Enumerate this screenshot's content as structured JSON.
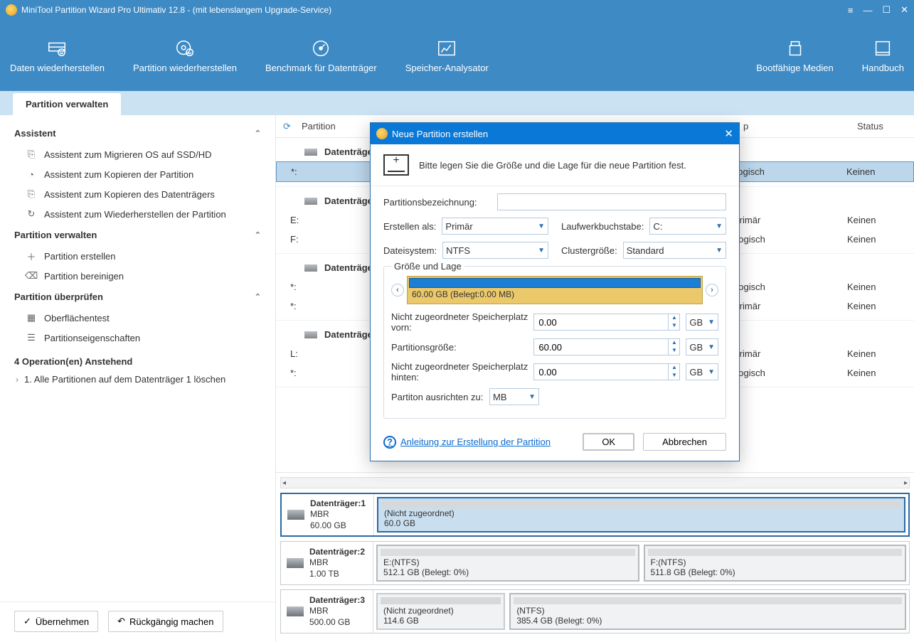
{
  "titlebar": {
    "title": "MiniTool Partition Wizard Pro Ultimativ 12.8 - (mit lebenslangem Upgrade-Service)"
  },
  "ribbon": {
    "items": [
      {
        "label": "Daten wiederherstellen"
      },
      {
        "label": "Partition wiederherstellen"
      },
      {
        "label": "Benchmark für Datenträger"
      },
      {
        "label": "Speicher-Analysator"
      }
    ],
    "right": [
      {
        "label": "Bootfähige Medien"
      },
      {
        "label": "Handbuch"
      }
    ]
  },
  "tab": {
    "label": "Partition verwalten"
  },
  "sidebar": {
    "sections": [
      {
        "title": "Assistent",
        "items": [
          "Assistent zum Migrieren OS auf SSD/HD",
          "Assistent zum Kopieren der Partition",
          "Assistent zum Kopieren des Datenträgers",
          "Assistent zum Wiederherstellen der Partition"
        ]
      },
      {
        "title": "Partition verwalten",
        "items": [
          "Partition erstellen",
          "Partition bereinigen"
        ]
      },
      {
        "title": "Partition überprüfen",
        "items": [
          "Oberflächentest",
          "Partitionseigenschaften"
        ]
      }
    ],
    "pending_title": "4 Operation(en) Anstehend",
    "pending_item": "1. Alle Partitionen auf dem Datenträger 1 löschen",
    "apply": "Übernehmen",
    "undo": "Rückgängig machen"
  },
  "list": {
    "col_partition": "Partition",
    "col_type": "p",
    "col_status": "Status",
    "disks": [
      {
        "name": "Datenträger 1",
        "rows": [
          {
            "label": "*:",
            "type": "Logisch",
            "status": "Keinen",
            "selected": true
          }
        ]
      },
      {
        "name": "Datenträger 2",
        "rows": [
          {
            "label": "E:",
            "type": "Primär",
            "status": "Keinen"
          },
          {
            "label": "F:",
            "type": "Logisch",
            "status": "Keinen"
          }
        ]
      },
      {
        "name": "Datenträger 3",
        "rows": [
          {
            "label": "*:",
            "type": "Logisch",
            "status": "Keinen"
          },
          {
            "label": "*:",
            "type": "Primär",
            "status": "Keinen"
          }
        ]
      },
      {
        "name": "Datenträger 4",
        "rows": [
          {
            "label": "L:",
            "type": "Primär",
            "status": "Keinen"
          },
          {
            "label": "*:",
            "type": "Logisch",
            "status": "Keinen"
          }
        ]
      }
    ]
  },
  "map": [
    {
      "name": "Datenträger:1",
      "scheme": "MBR",
      "size": "60.00 GB",
      "selected": true,
      "parts": [
        {
          "title": "(Nicht zugeordnet)",
          "sub": "60.0 GB",
          "cls": "unalloc selected",
          "flex": 1
        }
      ]
    },
    {
      "name": "Datenträger:2",
      "scheme": "MBR",
      "size": "1.00 TB",
      "parts": [
        {
          "title": "E:(NTFS)",
          "sub": "512.1 GB (Belegt: 0%)",
          "cls": "ntfs",
          "flex": 1
        },
        {
          "title": "F:(NTFS)",
          "sub": "511.8 GB (Belegt: 0%)",
          "cls": "ntfs",
          "flex": 1
        }
      ]
    },
    {
      "name": "Datenträger:3",
      "scheme": "MBR",
      "size": "500.00 GB",
      "parts": [
        {
          "title": "(Nicht zugeordnet)",
          "sub": "114.6 GB",
          "cls": "unalloc",
          "flex": 0.3
        },
        {
          "title": "(NTFS)",
          "sub": "385.4 GB (Belegt: 0%)",
          "cls": "ntfs",
          "flex": 1
        }
      ]
    }
  ],
  "dialog": {
    "title": "Neue Partition erstellen",
    "intro": "Bitte legen Sie die Größe und die Lage für die neue Partition fest.",
    "label_partition_label": "Partitionsbezeichnung:",
    "label_create_as": "Erstellen als:",
    "val_create_as": "Primär",
    "label_drive_letter": "Laufwerkbuchstabe:",
    "val_drive_letter": "C:",
    "label_fs": "Dateisystem:",
    "val_fs": "NTFS",
    "label_cluster": "Clustergröße:",
    "val_cluster": "Standard",
    "fieldset_title": "Größe und Lage",
    "size_text": "60.00 GB (Belegt:0.00 MB)",
    "label_unalloc_before": "Nicht zugeordneter Speicherplatz vorn:",
    "val_unalloc_before": "0.00",
    "label_part_size": "Partitionsgröße:",
    "val_part_size": "60.00",
    "label_unalloc_after": "Nicht zugeordneter Speicherplatz hinten:",
    "val_unalloc_after": "0.00",
    "unit": "GB",
    "label_align": "Partiton ausrichten zu:",
    "val_align": "MB",
    "help": "Anleitung zur Erstellung der Partition",
    "ok": "OK",
    "cancel": "Abbrechen"
  }
}
